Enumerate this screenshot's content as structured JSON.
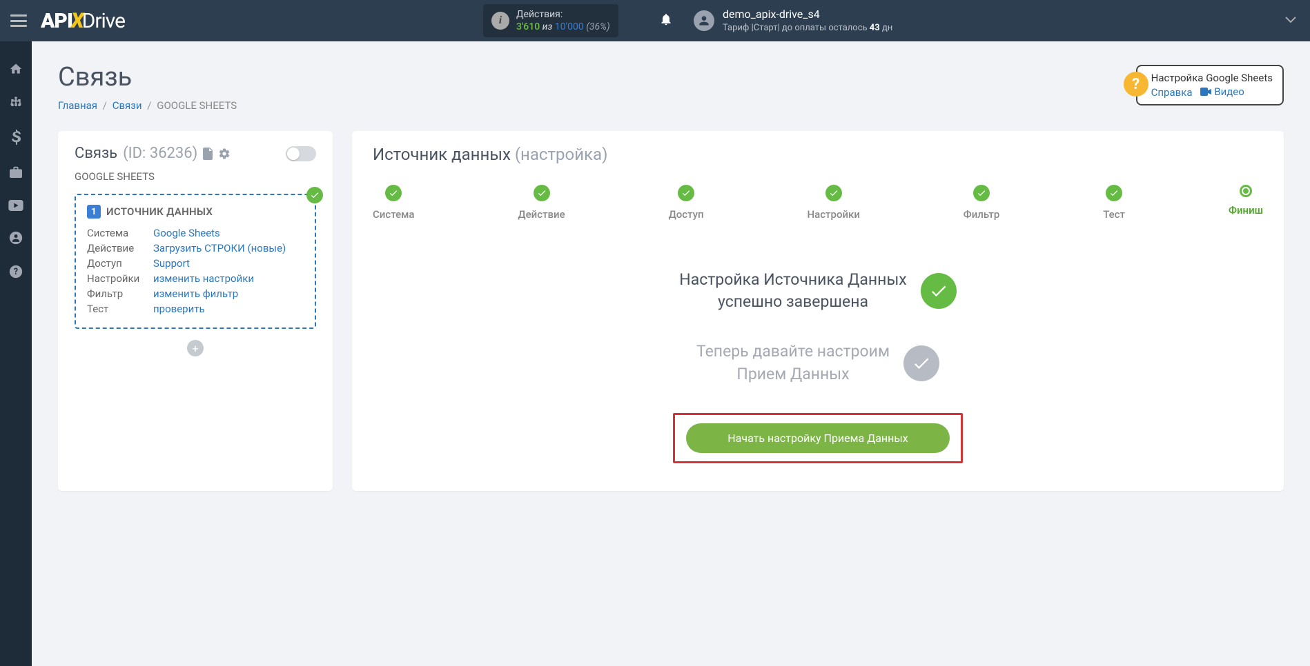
{
  "header": {
    "actions_label": "Действия:",
    "actions_count": "3'610",
    "actions_of": "из",
    "actions_total": "10'000",
    "actions_pct": "(36%)",
    "user_name": "demo_apix-drive_s4",
    "tariff_prefix": "Тариф |Старт|  до оплаты осталось ",
    "tariff_days": "43",
    "tariff_suffix": " дн"
  },
  "page": {
    "title": "Связь",
    "bc_home": "Главная",
    "bc_links": "Связи",
    "bc_current": "GOOGLE SHEETS"
  },
  "help": {
    "title": "Настройка Google Sheets",
    "ref": "Справка",
    "video": "Видео"
  },
  "left": {
    "title": "Связь",
    "id_label": "(ID: 36236)",
    "sub": "GOOGLE SHEETS",
    "heading": "ИСТОЧНИК ДАННЫХ",
    "rows": {
      "system_l": "Система",
      "system_v": "Google Sheets",
      "action_l": "Действие",
      "action_v": "Загрузить СТРОКИ (новые)",
      "access_l": "Доступ",
      "access_v": "Support",
      "settings_l": "Настройки",
      "settings_v": "изменить настройки",
      "filter_l": "Фильтр",
      "filter_v": "изменить фильтр",
      "test_l": "Тест",
      "test_v": "проверить"
    }
  },
  "right": {
    "title": "Источник данных",
    "title_sub": "(настройка)",
    "steps": {
      "s1": "Система",
      "s2": "Действие",
      "s3": "Доступ",
      "s4": "Настройки",
      "s5": "Фильтр",
      "s6": "Тест",
      "s7": "Финиш"
    },
    "done1": "Настройка Источника Данных",
    "done2": "успешно завершена",
    "next1": "Теперь давайте настроим",
    "next2": "Прием Данных",
    "cta": "Начать настройку Приема Данных"
  }
}
